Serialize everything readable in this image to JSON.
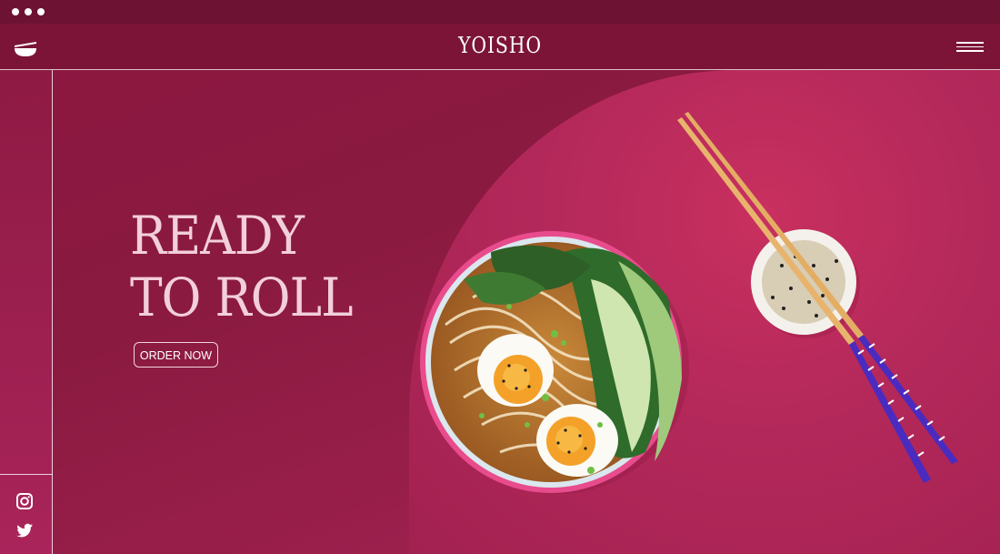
{
  "window": {
    "dots": 3
  },
  "header": {
    "brand": "YOISHO",
    "logo_icon": "bowl-icon",
    "menu_icon": "hamburger-menu-icon"
  },
  "hero": {
    "line1": "READY",
    "line2": "TO ROLL",
    "cta_label": "ORDER NOW"
  },
  "social": [
    {
      "name": "instagram-icon"
    },
    {
      "name": "twitter-icon"
    }
  ],
  "colors": {
    "header_bg": "#7b1437",
    "main_bg": "#8a1a40",
    "arch_bg": "#c02c5c",
    "title_text": "#f2cfdb"
  }
}
